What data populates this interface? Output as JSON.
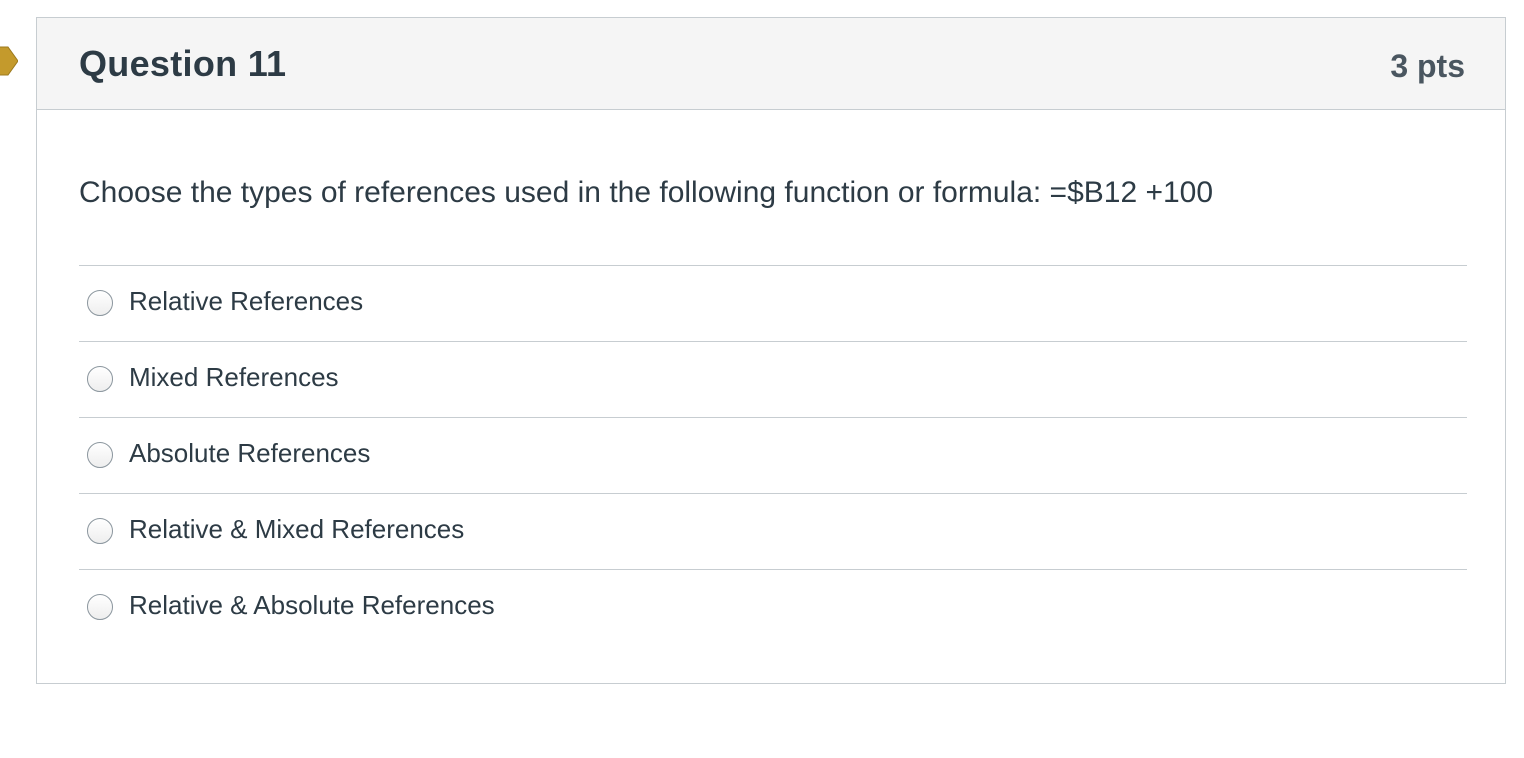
{
  "question": {
    "title": "Question 11",
    "points": "3 pts",
    "text": "Choose the types of references used in the following function or formula: =$B12 +100",
    "flag_color": "#c49a2c"
  },
  "answers": [
    {
      "label": "Relative References",
      "selected": false
    },
    {
      "label": "Mixed References",
      "selected": false
    },
    {
      "label": "Absolute References",
      "selected": false
    },
    {
      "label": "Relative & Mixed References",
      "selected": false
    },
    {
      "label": "Relative & Absolute References",
      "selected": false
    }
  ]
}
